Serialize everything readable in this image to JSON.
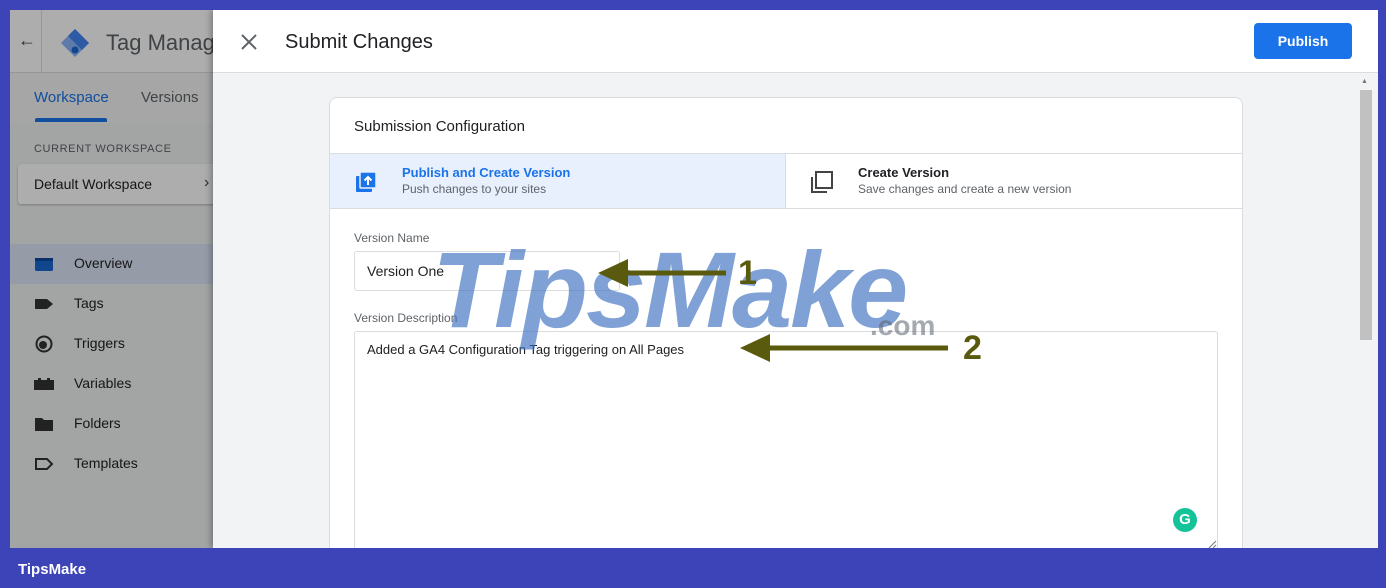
{
  "app": {
    "title": "Tag Manage",
    "tabs": [
      {
        "label": "Workspace",
        "active": true
      },
      {
        "label": "Versions",
        "active": false
      }
    ],
    "workspace_caption": "CURRENT WORKSPACE",
    "workspace_name": "Default Workspace",
    "menu": [
      {
        "label": "Overview",
        "icon": "overview-icon",
        "active": true
      },
      {
        "label": "Tags",
        "icon": "tag-icon",
        "active": false
      },
      {
        "label": "Triggers",
        "icon": "trigger-icon",
        "active": false
      },
      {
        "label": "Variables",
        "icon": "variables-icon",
        "active": false
      },
      {
        "label": "Folders",
        "icon": "folder-icon",
        "active": false
      },
      {
        "label": "Templates",
        "icon": "template-icon",
        "active": false
      }
    ]
  },
  "dialog": {
    "title": "Submit Changes",
    "publish_label": "Publish",
    "card_title": "Submission Configuration",
    "options": [
      {
        "title": "Publish and Create Version",
        "subtitle": "Push changes to your sites",
        "icon": "publish-icon",
        "selected": true
      },
      {
        "title": "Create Version",
        "subtitle": "Save changes and create a new version",
        "icon": "create-version-icon",
        "selected": false
      }
    ],
    "version_name_label": "Version Name",
    "version_name_value": "Version One",
    "version_description_label": "Version Description",
    "version_description_value": "Added a GA4 Configuration Tag triggering on All Pages"
  },
  "annotations": {
    "callout_1": "1",
    "callout_2": "2",
    "watermark": "TipsMake",
    "watermark_suffix": ".com"
  },
  "footer": {
    "brand": "TipsMake"
  },
  "colors": {
    "accent": "#1a73e8",
    "frame": "#3c44b8",
    "arrow": "#5a5a0e"
  }
}
